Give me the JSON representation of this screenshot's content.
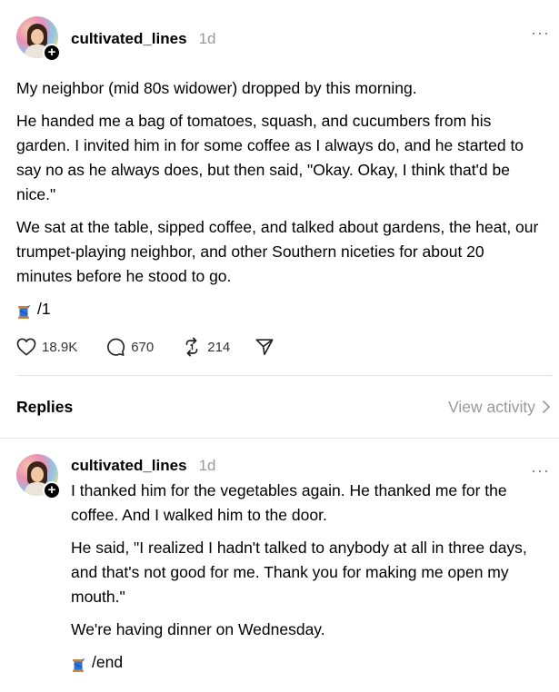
{
  "post": {
    "username": "cultivated_lines",
    "time": "1d",
    "more_label": "···",
    "plus_label": "+",
    "paragraphs": [
      "My neighbor (mid 80s widower) dropped by this morning.",
      "He handed me a bag of tomatoes, squash, and cucumbers from his garden. I invited him in for some coffee as I always do, and he started to say no as he always does, but then said, \"Okay. Okay, I think that'd be nice.\"",
      "We sat at the table, sipped coffee, and talked about gardens, the heat, our trumpet-playing neighbor, and other Southern niceties for about 20 minutes before he stood to go."
    ],
    "thread_marker": "/1",
    "likes": "18.9K",
    "comments": "670",
    "reposts": "214"
  },
  "replies_section": {
    "title": "Replies",
    "view_activity": "View activity"
  },
  "reply": {
    "username": "cultivated_lines",
    "time": "1d",
    "more_label": "···",
    "plus_label": "+",
    "paragraphs": [
      "I thanked him for the vegetables again. He thanked me for the coffee. And I walked him to the door.",
      "He said, \"I realized I hadn't talked to anybody at all in three days, and that's not good for me. Thank you for making me open my mouth.\"",
      "We're having dinner on Wednesday."
    ],
    "thread_marker": "/end"
  },
  "icons": {
    "like": "heart-icon",
    "comment": "comment-bubble-icon",
    "repost": "repost-icon",
    "share": "send-icon",
    "thread": "thread-spool-emoji",
    "chevron": "chevron-right-icon"
  },
  "colors": {
    "text": "#000000",
    "muted": "#999999",
    "divider": "#e4e4e4"
  }
}
